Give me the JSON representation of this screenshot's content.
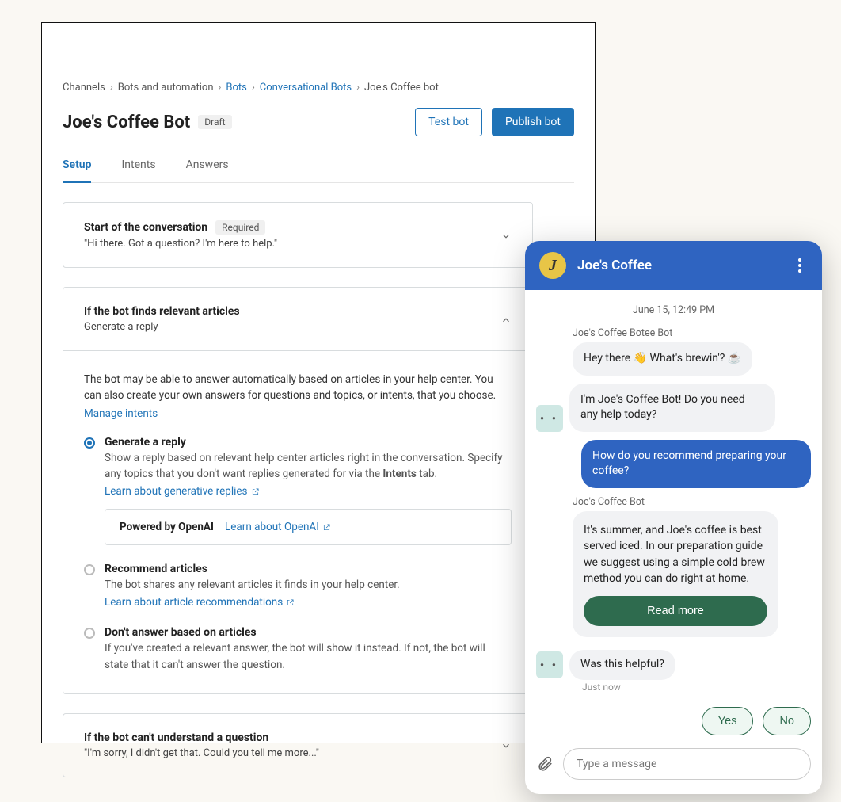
{
  "breadcrumb": {
    "c0": "Channels",
    "c1": "Bots and automation",
    "c2": "Bots",
    "c3": "Conversational Bots",
    "c4": "Joe's Coffee bot"
  },
  "page": {
    "title": "Joe's Coffee Bot",
    "status": "Draft",
    "test_btn": "Test bot",
    "publish_btn": "Publish bot"
  },
  "tabs": {
    "setup": "Setup",
    "intents": "Intents",
    "answers": "Answers"
  },
  "card_start": {
    "title": "Start of the conversation",
    "required": "Required",
    "sub": "\"Hi there. Got a question? I'm here to help.\""
  },
  "card_articles": {
    "title": "If the bot finds relevant articles",
    "sub": "Generate a reply",
    "desc": "The bot may be able to answer automatically based on articles in your help center. You can also create your own answers for questions and topics, or intents, that you choose.",
    "manage_intents": "Manage intents",
    "options": {
      "generate": {
        "title": "Generate a reply",
        "desc_a": "Show a reply based on relevant help center articles right in the conversation. Specify any topics that you don't want replies generated for via the ",
        "desc_bold": "Intents",
        "desc_b": " tab.",
        "learn": "Learn about generative replies",
        "openai_label": "Powered by OpenAI",
        "openai_link": "Learn about OpenAI"
      },
      "recommend": {
        "title": "Recommend articles",
        "desc": "The bot shares any relevant articles it finds in your help center.",
        "learn": "Learn about article recommendations"
      },
      "dont": {
        "title": "Don't answer based on articles",
        "desc": "If you've created a relevant answer, the bot will show it instead. If not, the bot will state that it can't answer the question."
      }
    }
  },
  "card_cant": {
    "title": "If the bot can't understand a question",
    "sub": "\"I'm sorry, I didn't get that. Could you tell me more...\""
  },
  "chat": {
    "title": "Joe's Coffee",
    "avatar_initial": "J",
    "timestamp": "June 15, 12:49 PM",
    "sender1": "Joe's Coffee Botee Bot",
    "msg1": "Hey there 👋 What's brewin'? ☕",
    "msg2": "I'm Joe's Coffee Bot! Do you need any help today?",
    "user1": "How do you recommend preparing your coffee?",
    "sender2": "Joe's Coffee Bot",
    "answer": "It's summer, and Joe's coffee is best served iced. In our preparation guide we suggest using a simple cold brew method you can do right at home.",
    "read_more": "Read more",
    "followup": "Was this helpful?",
    "ts_small": "Just now",
    "yes": "Yes",
    "no": "No",
    "placeholder": "Type a message"
  }
}
